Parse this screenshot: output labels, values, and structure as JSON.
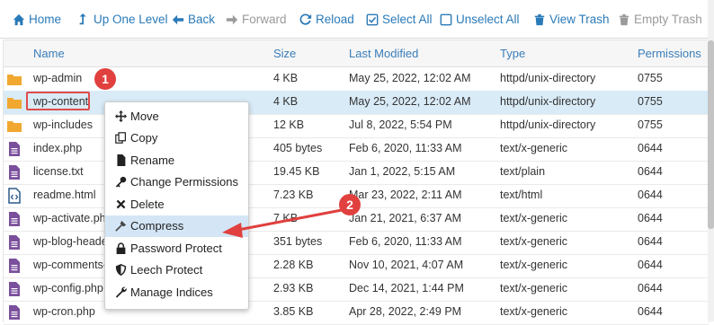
{
  "toolbar": {
    "home": "Home",
    "up": "Up One Level",
    "back": "Back",
    "forward": "Forward",
    "reload": "Reload",
    "select_all": "Select All",
    "unselect_all": "Unselect All",
    "view_trash": "View Trash",
    "empty_trash": "Empty Trash"
  },
  "columns": {
    "name": "Name",
    "size": "Size",
    "modified": "Last Modified",
    "type": "Type",
    "permissions": "Permissions"
  },
  "rows": [
    {
      "name": "wp-admin",
      "size": "4 KB",
      "modified": "May 25, 2022, 12:02 AM",
      "type": "httpd/unix-directory",
      "perm": "0755",
      "kind": "folder"
    },
    {
      "name": "wp-content",
      "size": "4 KB",
      "modified": "May 25, 2022, 12:02 AM",
      "type": "httpd/unix-directory",
      "perm": "0755",
      "kind": "folder"
    },
    {
      "name": "wp-includes",
      "size": "12 KB",
      "modified": "Jul 8, 2022, 5:54 PM",
      "type": "httpd/unix-directory",
      "perm": "0755",
      "kind": "folder"
    },
    {
      "name": "index.php",
      "size": "405 bytes",
      "modified": "Feb 6, 2020, 11:33 AM",
      "type": "text/x-generic",
      "perm": "0644",
      "kind": "file"
    },
    {
      "name": "license.txt",
      "size": "19.45 KB",
      "modified": "Jan 1, 2022, 5:15 AM",
      "type": "text/plain",
      "perm": "0644",
      "kind": "file"
    },
    {
      "name": "readme.html",
      "size": "7.23 KB",
      "modified": "Mar 23, 2022, 2:11 AM",
      "type": "text/html",
      "perm": "0644",
      "kind": "html"
    },
    {
      "name": "wp-activate.php",
      "size": "7 KB",
      "modified": "Jan 21, 2021, 6:37 AM",
      "type": "text/x-generic",
      "perm": "0644",
      "kind": "file"
    },
    {
      "name": "wp-blog-header.php",
      "size": "351 bytes",
      "modified": "Feb 6, 2020, 11:33 AM",
      "type": "text/x-generic",
      "perm": "0644",
      "kind": "file"
    },
    {
      "name": "wp-comments-post.php",
      "size": "2.28 KB",
      "modified": "Nov 10, 2021, 4:07 AM",
      "type": "text/x-generic",
      "perm": "0644",
      "kind": "file"
    },
    {
      "name": "wp-config.php",
      "size": "2.93 KB",
      "modified": "Dec 14, 2021, 1:44 PM",
      "type": "text/x-generic",
      "perm": "0644",
      "kind": "file"
    },
    {
      "name": "wp-cron.php",
      "size": "3.85 KB",
      "modified": "Apr 28, 2022, 2:49 PM",
      "type": "text/x-generic",
      "perm": "0644",
      "kind": "file"
    }
  ],
  "context_menu": [
    {
      "label": "Move",
      "icon": "move-icon"
    },
    {
      "label": "Copy",
      "icon": "copy-icon"
    },
    {
      "label": "Rename",
      "icon": "rename-icon"
    },
    {
      "label": "Change Permissions",
      "icon": "key-icon"
    },
    {
      "label": "Delete",
      "icon": "delete-icon"
    },
    {
      "label": "Compress",
      "icon": "compress-icon"
    },
    {
      "label": "Password Protect",
      "icon": "lock-icon"
    },
    {
      "label": "Leech Protect",
      "icon": "shield-icon"
    },
    {
      "label": "Manage Indices",
      "icon": "wrench-icon"
    }
  ],
  "annotations": {
    "step1": "1",
    "step2": "2"
  },
  "colors": {
    "link": "#2a7ab8",
    "selected_row": "#d9ebf7",
    "annotation_red": "#e0403e",
    "folder": "#f0a830",
    "file": "#7a4f9b"
  }
}
